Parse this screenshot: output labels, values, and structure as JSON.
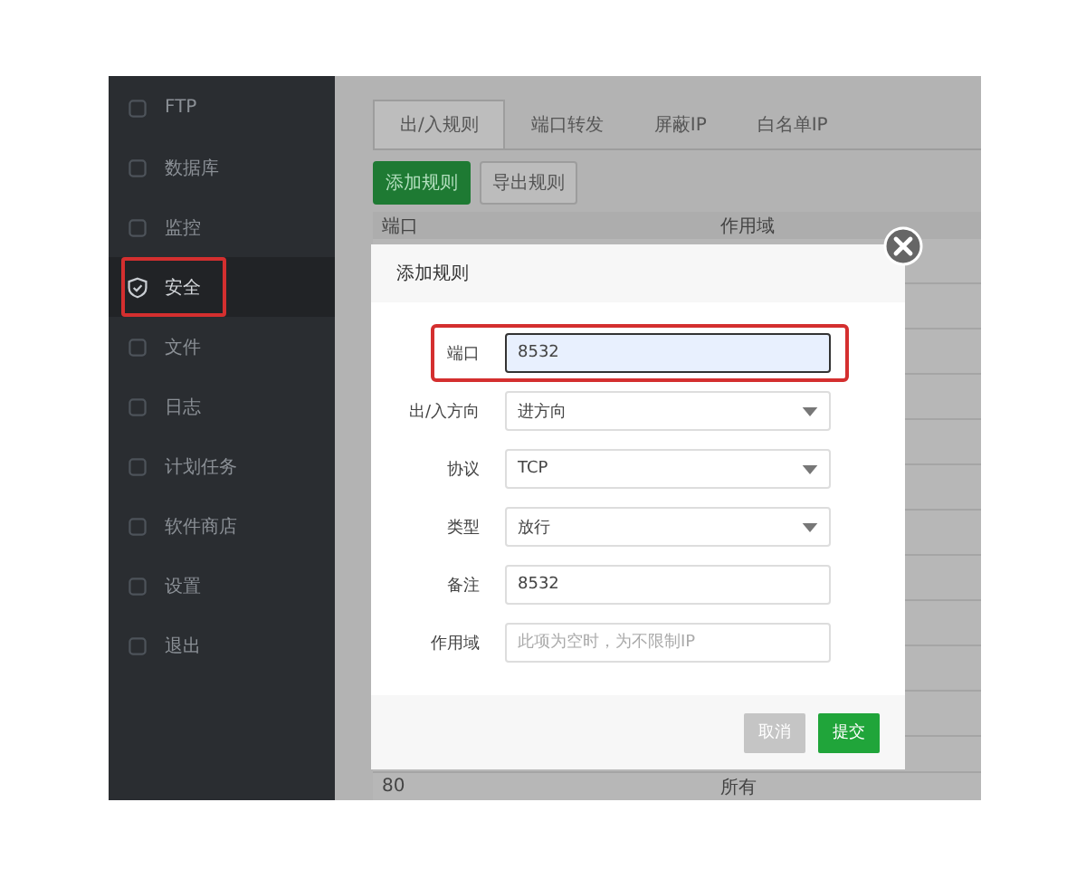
{
  "sidebar": {
    "items": [
      {
        "label": "FTP",
        "selected": false,
        "annotated": false
      },
      {
        "label": "数据库",
        "selected": false,
        "annotated": false
      },
      {
        "label": "监控",
        "selected": false,
        "annotated": false
      },
      {
        "label": "安全",
        "selected": true,
        "annotated": true
      },
      {
        "label": "文件",
        "selected": false,
        "annotated": false
      },
      {
        "label": "日志",
        "selected": false,
        "annotated": false
      },
      {
        "label": "计划任务",
        "selected": false,
        "annotated": false
      },
      {
        "label": "软件商店",
        "selected": false,
        "annotated": false
      },
      {
        "label": "设置",
        "selected": false,
        "annotated": false
      },
      {
        "label": "退出",
        "selected": false,
        "annotated": false
      }
    ]
  },
  "tabs": [
    {
      "label": "出/入规则",
      "selected": true
    },
    {
      "label": "端口转发",
      "selected": false
    },
    {
      "label": "屏蔽IP",
      "selected": false
    },
    {
      "label": "白名单IP",
      "selected": false
    }
  ],
  "toolbar": {
    "buttons": [
      {
        "label": "添加规则",
        "kind": "primary"
      },
      {
        "label": "导出规则",
        "kind": "default"
      }
    ]
  },
  "table": {
    "columns": [
      "端口",
      "作用域"
    ],
    "rows": [
      [
        "80",
        "所有"
      ]
    ]
  },
  "dialog": {
    "title": "添加规则",
    "fields": [
      {
        "label": "端口",
        "kind": "input",
        "value": "8532",
        "focused": true,
        "annotated": true
      },
      {
        "label": "出/入方向",
        "kind": "select",
        "value": "进方向",
        "focused": false,
        "annotated": false
      },
      {
        "label": "协议",
        "kind": "select",
        "value": "TCP",
        "focused": false,
        "annotated": false
      },
      {
        "label": "类型",
        "kind": "select",
        "value": "放行",
        "focused": false,
        "annotated": false
      },
      {
        "label": "备注",
        "kind": "input",
        "value": "8532",
        "focused": false,
        "annotated": false
      },
      {
        "label": "作用域",
        "kind": "input",
        "placeholder": "此项为空时，为不限制IP",
        "focused": false,
        "annotated": false
      }
    ],
    "buttons": [
      {
        "label": "取消",
        "kind": "disabled"
      },
      {
        "label": "提交",
        "kind": "primary"
      }
    ]
  }
}
